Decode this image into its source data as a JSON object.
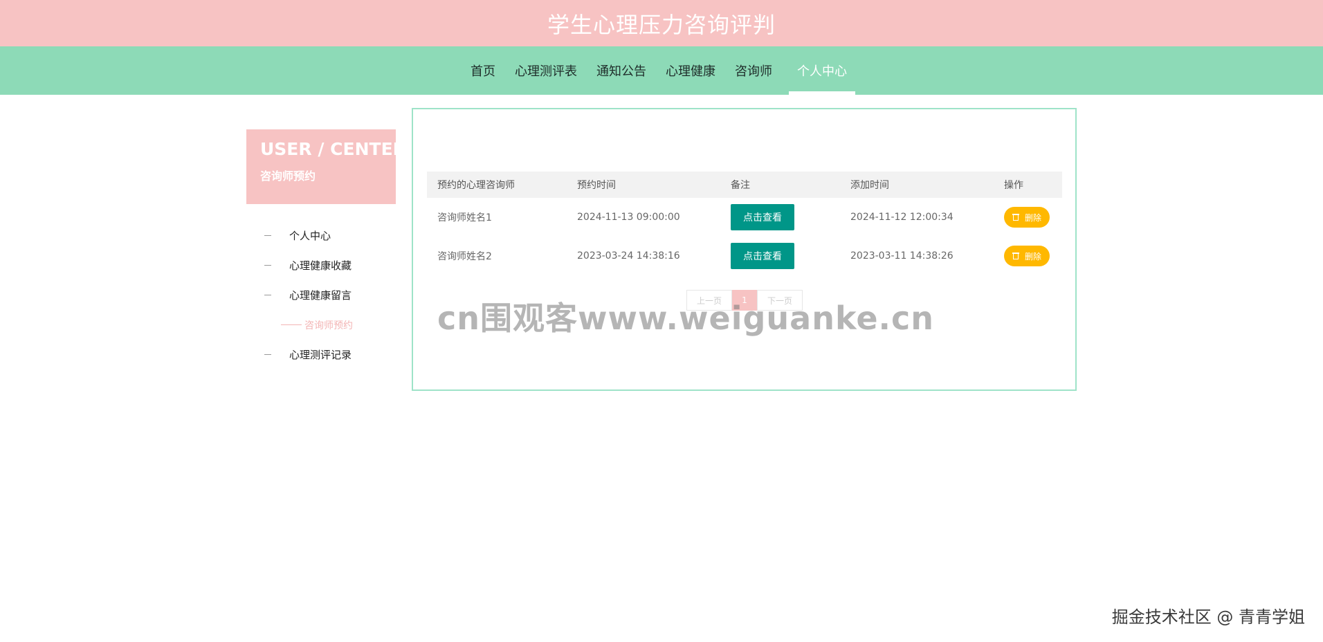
{
  "header": {
    "title": "学生心理压力咨询评判"
  },
  "nav": {
    "items": [
      {
        "label": "首页"
      },
      {
        "label": "心理测评表"
      },
      {
        "label": "通知公告"
      },
      {
        "label": "心理健康"
      },
      {
        "label": "咨询师"
      },
      {
        "label": "个人中心"
      }
    ],
    "active": "个人中心"
  },
  "sidebar": {
    "title_en": "USER / CENTER",
    "title_cn": "咨询师预约",
    "items": [
      {
        "label": "个人中心"
      },
      {
        "label": "心理健康收藏"
      },
      {
        "label": "心理健康留言"
      },
      {
        "label": "咨询师预约"
      },
      {
        "label": "心理测评记录"
      }
    ],
    "current": "咨询师预约"
  },
  "table": {
    "headers": [
      "预约的心理咨询师",
      "预约时间",
      "备注",
      "添加时间",
      "操作"
    ],
    "rows": [
      {
        "counselor": "咨询师姓名1",
        "time": "2024-11-13 09:00:00",
        "note_button": "点击查看",
        "added": "2024-11-12 12:00:34",
        "action": "删除"
      },
      {
        "counselor": "咨询师姓名2",
        "time": "2023-03-24 14:38:16",
        "note_button": "点击查看",
        "added": "2023-03-11 14:38:26",
        "action": "删除"
      }
    ]
  },
  "pagination": {
    "prev": "上一页",
    "current": "1",
    "next": "下一页"
  },
  "watermark": "cn围观客www.weiguanke.cn",
  "credit": "掘金技术社区 @ 青青学姐",
  "colors": {
    "pink": "#f7c3c3",
    "mint": "#8ddab7",
    "teal": "#009688",
    "amber": "#ffb800"
  }
}
